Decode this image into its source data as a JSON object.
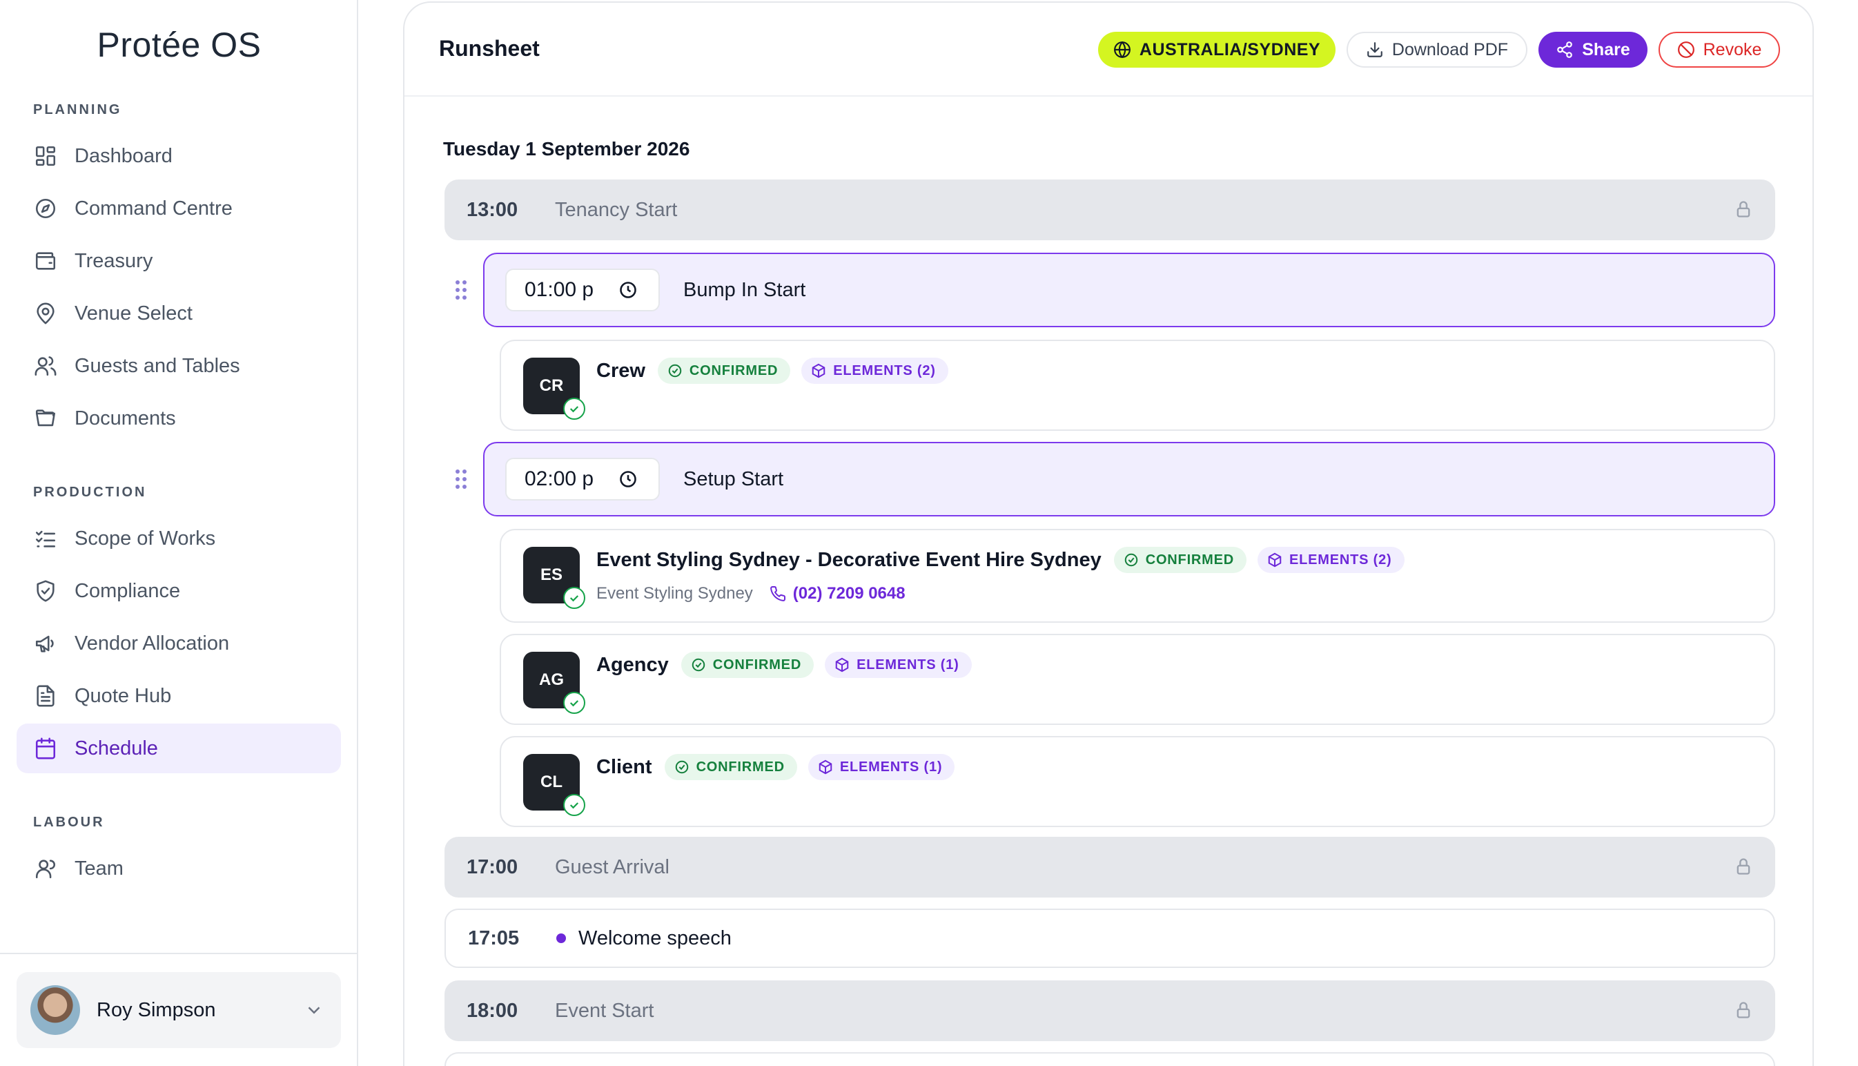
{
  "app": {
    "brand": "Protée OS"
  },
  "sidebar": {
    "sections": [
      {
        "title": "PLANNING",
        "items": [
          {
            "label": "Dashboard",
            "icon": "dashboard-icon"
          },
          {
            "label": "Command Centre",
            "icon": "compass-icon"
          },
          {
            "label": "Treasury",
            "icon": "wallet-icon"
          },
          {
            "label": "Venue Select",
            "icon": "map-pin-icon"
          },
          {
            "label": "Guests and Tables",
            "icon": "users-icon"
          },
          {
            "label": "Documents",
            "icon": "folder-icon"
          }
        ]
      },
      {
        "title": "PRODUCTION",
        "items": [
          {
            "label": "Scope of Works",
            "icon": "list-check-icon"
          },
          {
            "label": "Compliance",
            "icon": "shield-check-icon"
          },
          {
            "label": "Vendor Allocation",
            "icon": "megaphone-icon"
          },
          {
            "label": "Quote Hub",
            "icon": "file-text-icon"
          },
          {
            "label": "Schedule",
            "icon": "calendar-icon",
            "active": true
          }
        ]
      },
      {
        "title": "LABOUR",
        "items": [
          {
            "label": "Team",
            "icon": "user-icon"
          }
        ]
      }
    ],
    "user": {
      "name": "Roy Simpson"
    }
  },
  "header": {
    "title": "Runsheet",
    "timezone": "AUSTRALIA/SYDNEY",
    "download_label": "Download PDF",
    "share_label": "Share",
    "revoke_label": "Revoke"
  },
  "colors": {
    "accent": "#6d28d9",
    "timezone_bg": "#d4f521",
    "confirmed": "#15803d",
    "danger": "#dc2626"
  },
  "schedule": {
    "date": "Tuesday 1 September 2026",
    "fixed": [
      {
        "time": "13:00",
        "label": "Tenancy Start"
      },
      {
        "time": "17:00",
        "label": "Guest Arrival"
      },
      {
        "time": "18:00",
        "label": "Event Start"
      }
    ],
    "editable": [
      {
        "time": "01:00 p",
        "label": "Bump In Start"
      },
      {
        "time": "02:00 p",
        "label": "Setup Start"
      }
    ],
    "vendors": [
      {
        "initials": "CR",
        "name": "Crew",
        "status": "CONFIRMED",
        "elements": "ELEMENTS (2)"
      },
      {
        "initials": "ES",
        "name": "Event Styling Sydney - Decorative Event Hire Sydney",
        "status": "CONFIRMED",
        "elements": "ELEMENTS (2)",
        "company": "Event Styling Sydney",
        "phone": "(02) 7209 0648"
      },
      {
        "initials": "AG",
        "name": "Agency",
        "status": "CONFIRMED",
        "elements": "ELEMENTS (1)"
      },
      {
        "initials": "CL",
        "name": "Client",
        "status": "CONFIRMED",
        "elements": "ELEMENTS (1)"
      }
    ],
    "events": [
      {
        "time": "17:05",
        "label": "Welcome speech"
      }
    ]
  }
}
